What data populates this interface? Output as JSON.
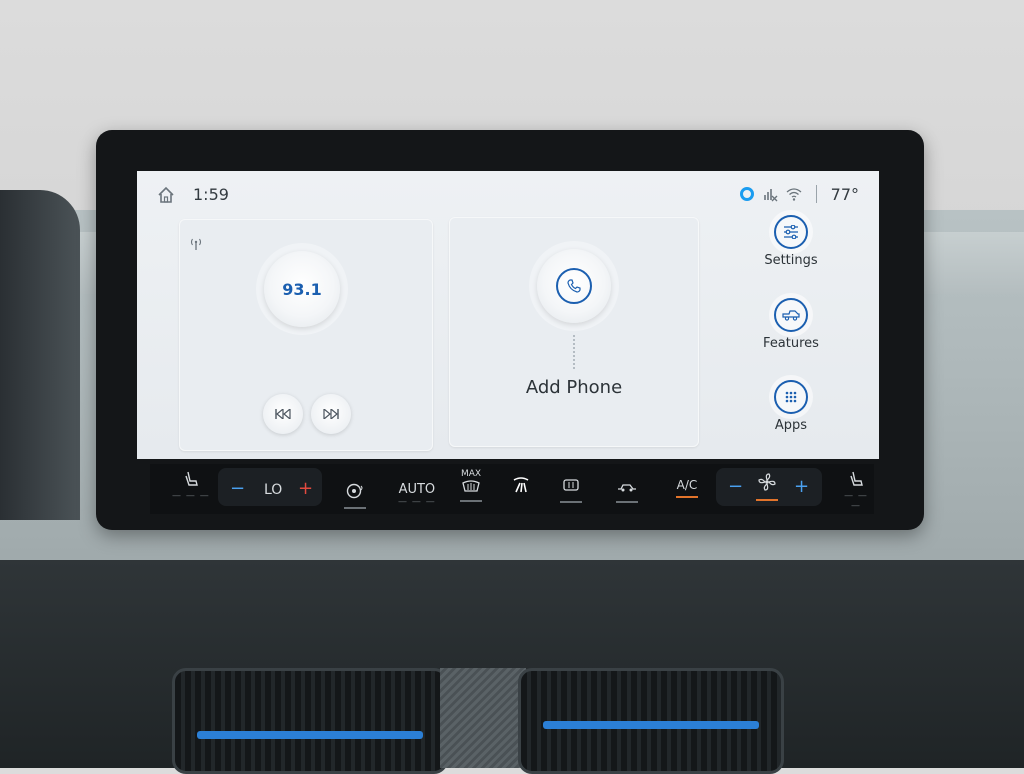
{
  "status": {
    "time": "1:59",
    "temperature": "77°"
  },
  "radio": {
    "frequency": "93.1"
  },
  "phone": {
    "label": "Add Phone"
  },
  "menu": {
    "settings": "Settings",
    "features": "Features",
    "apps": "Apps"
  },
  "climate": {
    "fan_temp": "LO",
    "minus": "−",
    "plus": "+",
    "auto": "AUTO",
    "max": "MAX",
    "ac": "A/C",
    "seat_dashes": "— — —"
  },
  "colors": {
    "accent": "#1b5fb0",
    "alexa": "#1a9cf0",
    "temp_plus": "#e24a3f",
    "fan_minus_plus": "#4aa1f0",
    "indicator_on": "#e2742b"
  }
}
